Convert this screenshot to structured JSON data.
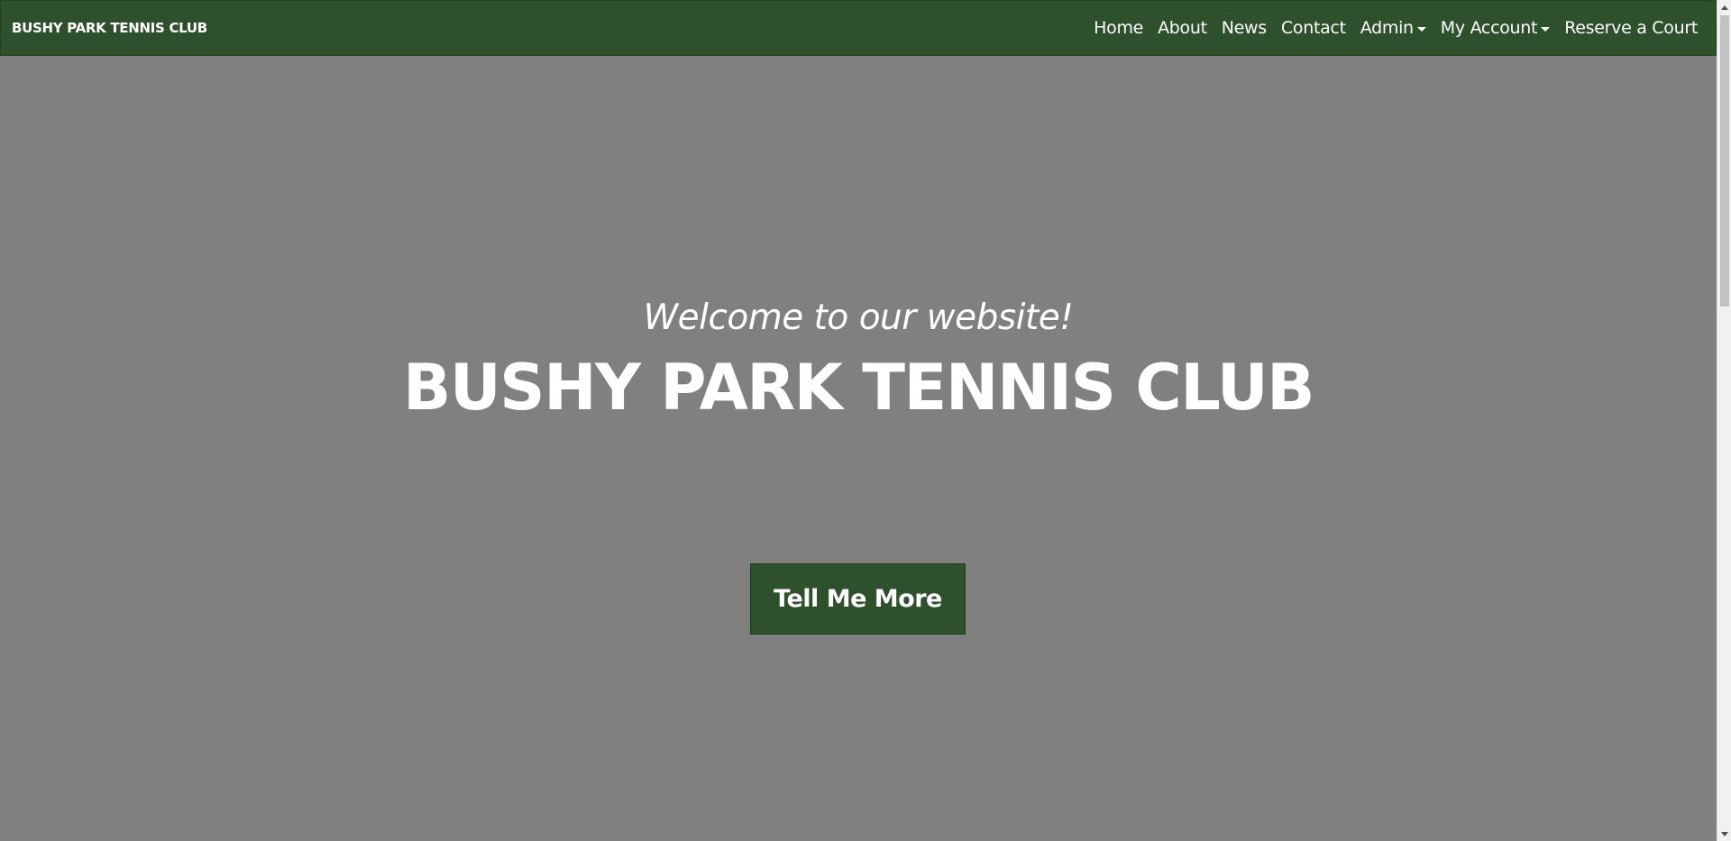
{
  "navbar": {
    "brand": "BUSHY PARK TENNIS CLUB",
    "links": [
      {
        "label": "Home",
        "dropdown": false
      },
      {
        "label": "About",
        "dropdown": false
      },
      {
        "label": "News",
        "dropdown": false
      },
      {
        "label": "Contact",
        "dropdown": false
      },
      {
        "label": "Admin",
        "dropdown": true
      },
      {
        "label": "My Account",
        "dropdown": true
      },
      {
        "label": "Reserve a Court",
        "dropdown": false
      }
    ]
  },
  "hero": {
    "welcome": "Welcome to our website!",
    "title": "BUSHY PARK TENNIS CLUB",
    "cta_label": "Tell Me More"
  },
  "colors": {
    "brand_green": "#2f502c",
    "hero_background": "#808080",
    "text": "#ffffff"
  }
}
